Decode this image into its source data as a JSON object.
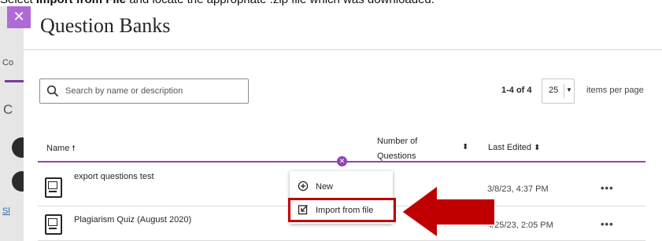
{
  "instruction": {
    "prefix": "Select ",
    "bold": "Import from File",
    "suffix": " and locate the appropriate .zip file which was downloaded."
  },
  "background": {
    "tab_label": "Co",
    "heading_initial": "C",
    "link_initial": "Sl"
  },
  "dialog": {
    "close_glyph": "✕",
    "title": "Question Banks"
  },
  "search": {
    "placeholder": "Search by name or description",
    "value": ""
  },
  "pagination": {
    "range": "1-4 of 4",
    "per_page": "25",
    "per_page_suffix": "items per page"
  },
  "table": {
    "columns": {
      "name": "Name",
      "number_line1": "Number of",
      "number_line2": "Questions",
      "last_edited": "Last Edited"
    },
    "rows": [
      {
        "name": "export questions test",
        "last_edited": "3/8/23, 4:37 PM",
        "more": "•••"
      },
      {
        "name": "Plagiarism Quiz (August 2020)",
        "last_edited": "4/25/23, 2:05 PM",
        "more": "•••"
      }
    ]
  },
  "add_menu": {
    "new_label": "New",
    "import_label": "Import from file"
  },
  "colors": {
    "accent_purple": "#8e44ad",
    "close_button": "#b06ad8",
    "annotation_red": "#c00000"
  },
  "icons": [
    "search-icon",
    "sort-up-icon",
    "sort-updown-icon",
    "add-circle-icon",
    "question-bank-icon",
    "more-options-icon",
    "new-plus-icon",
    "import-file-icon",
    "close-icon",
    "arrow-pointer-icon"
  ]
}
